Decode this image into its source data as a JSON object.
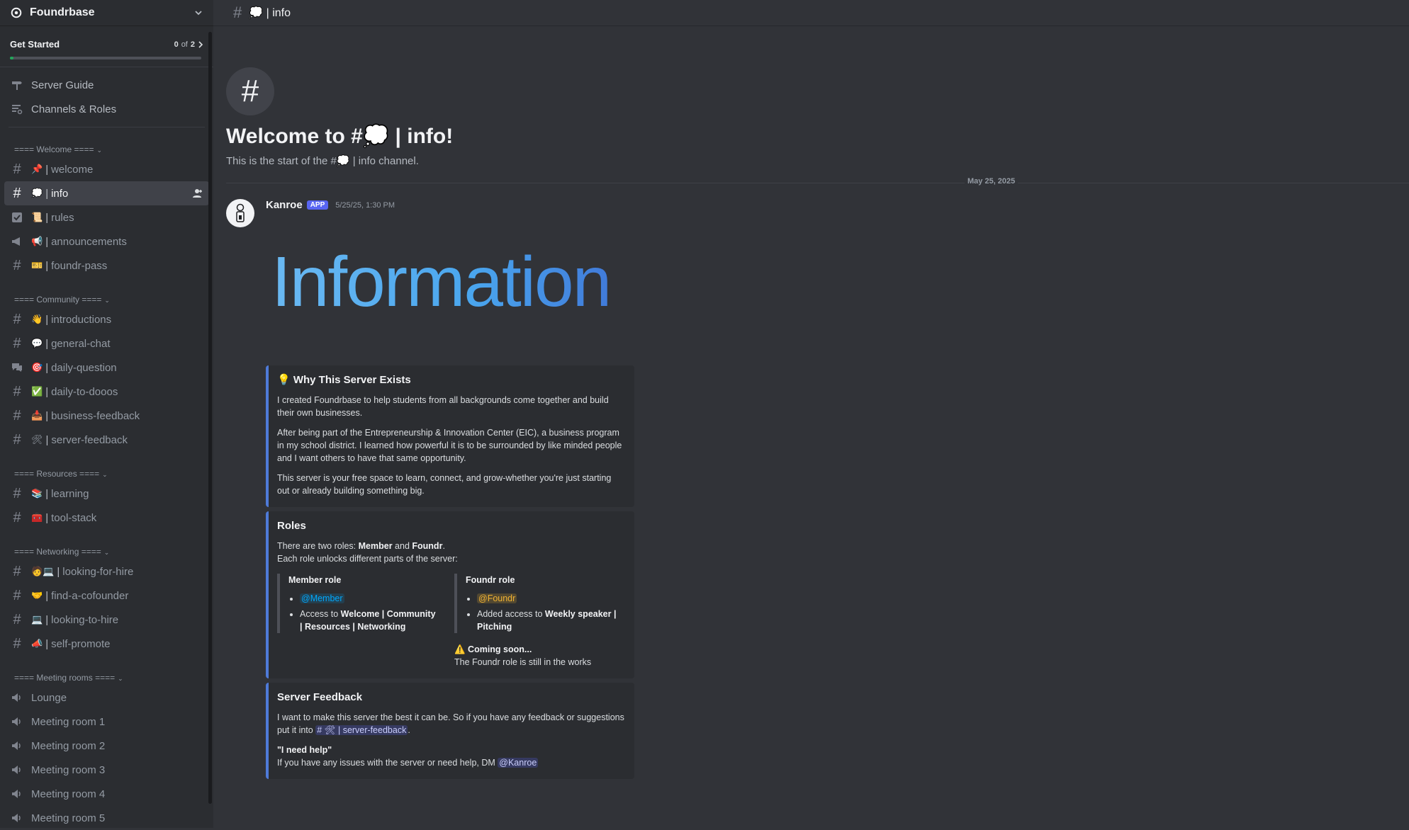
{
  "server": {
    "name": "Foundrbase"
  },
  "get_started": {
    "label": "Get Started",
    "done": "0",
    "of": "of",
    "total": "2",
    "progress": 0.02
  },
  "top_links": [
    {
      "label": "Server Guide",
      "icon": "signpost-icon"
    },
    {
      "label": "Channels & Roles",
      "icon": "channels-roles-icon"
    }
  ],
  "categories": {
    "welcome": "==== Welcome ====",
    "community": "==== Community ====",
    "resources": "==== Resources ====",
    "networking": "==== Networking ====",
    "meeting": "==== Meeting rooms ===="
  },
  "channels": {
    "welcome": {
      "emoji": "📌",
      "name": "welcome"
    },
    "info": {
      "emoji": "💭",
      "name": "info"
    },
    "rules": {
      "emoji": "📜",
      "name": "rules"
    },
    "announcements": {
      "emoji": "📢",
      "name": "announcements"
    },
    "foundr_pass": {
      "emoji": "🎫",
      "name": "foundr-pass"
    },
    "introductions": {
      "emoji": "👋",
      "name": "introductions"
    },
    "general_chat": {
      "emoji": "💬",
      "name": "general-chat"
    },
    "daily_question": {
      "emoji": "🎯",
      "name": "daily-question"
    },
    "daily_todos": {
      "emoji": "✅",
      "name": "daily-to-dooos"
    },
    "business_feedback": {
      "emoji": "📥",
      "name": "business-feedback"
    },
    "server_feedback": {
      "emoji": "🛠",
      "name": "server-feedback"
    },
    "learning": {
      "emoji": "📚",
      "name": "learning"
    },
    "tool_stack": {
      "emoji": "🧰",
      "name": "tool-stack"
    },
    "looking_for_hire": {
      "emoji": "🧑💻",
      "name": "looking-for-hire"
    },
    "find_cofounder": {
      "emoji": "🤝",
      "name": "find-a-cofounder"
    },
    "looking_to_hire": {
      "emoji": "💻",
      "name": "looking-to-hire"
    },
    "self_promote": {
      "emoji": "📣",
      "name": "self-promote"
    }
  },
  "voice": [
    "Lounge",
    "Meeting room 1",
    "Meeting room 2",
    "Meeting room 3",
    "Meeting room 4",
    "Meeting room 5"
  ],
  "topbar": {
    "channel": "💭 | info"
  },
  "intro": {
    "title": "Welcome to #💭 | info!",
    "subtitle": "This is the start of the #💭 | info channel.",
    "date": "May 25, 2025"
  },
  "message": {
    "author": "Kanroe",
    "badge": "APP",
    "timestamp": "5/25/25, 1:30 PM",
    "banner": "Information"
  },
  "embed_why": {
    "title": "💡 Why This Server Exists",
    "p1": "I created Foundrbase to help students from all backgrounds come together and build their own businesses.",
    "p2": "After being part of the Entrepreneurship & Innovation Center (EIC), a business program in my school district. I learned how powerful it is to be surrounded by like minded people and I want others to have that same opportunity.",
    "p3": "This server is your free space to learn, connect, and grow-whether you're just starting out or already building something big."
  },
  "embed_roles": {
    "title": "Roles",
    "line1_a": "There are two roles: ",
    "line1_member": "Member",
    "line1_and": " and ",
    "line1_foundr": "Foundr",
    "line1_end": ".",
    "line2": "Each role unlocks different parts of the server:",
    "member_title": "Member role",
    "member_mention": "@Member",
    "member_access_a": "Access to  ",
    "member_access_b": "Welcome | Community | Resources | Networking",
    "foundr_title": "Foundr role",
    "foundr_mention": "@Foundr",
    "foundr_access_a": "Added access to ",
    "foundr_access_b": "Weekly speaker | Pitching",
    "soon_title": "⚠️ Coming soon...",
    "soon_text": "The Foundr role is still in the works"
  },
  "embed_feedback": {
    "title": "Server Feedback",
    "p1": "I want to make this server the best it can be. So if you have any feedback or suggestions put it into ",
    "channel_mention": "# 🛠 | server-feedback",
    "p1_end": ".",
    "help_title": "\"I need help\"",
    "help_text": "If you have any issues with the server or need help, DM ",
    "dm_mention": "@Kanroe"
  },
  "colors": {
    "accent": "#5865f2",
    "embed_bar": "#4e7ad8",
    "progress": "#23a55a"
  }
}
